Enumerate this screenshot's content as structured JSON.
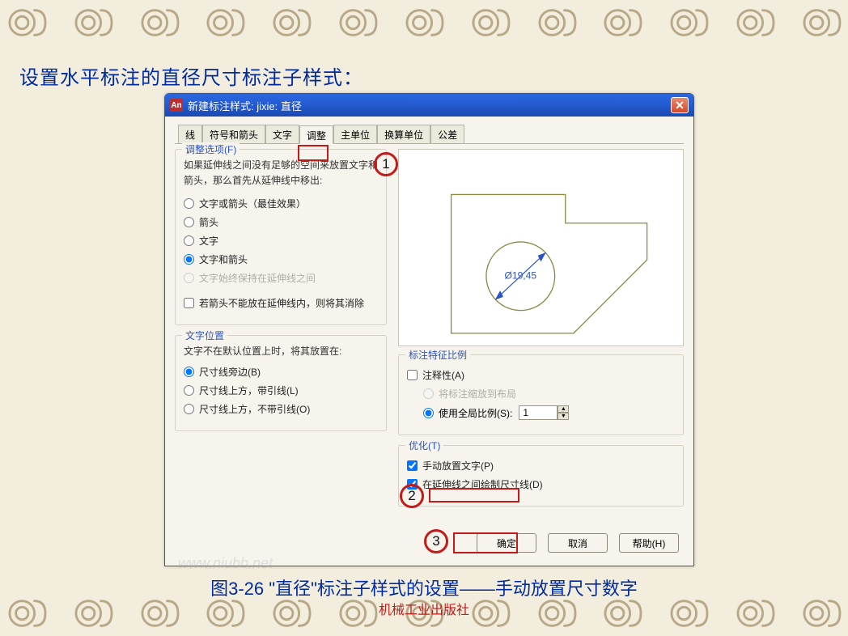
{
  "page": {
    "title": "设置水平标注的直径尺寸标注子样式：",
    "caption": "图3-26  \"直径\"标注子样式的设置——手动放置尺寸数字",
    "publisher": "机械工业出版社",
    "watermark": "www.niubb.net"
  },
  "dialog": {
    "title": "新建标注样式: jixie: 直径",
    "app_icon_text": "An",
    "tabs": [
      "线",
      "符号和箭头",
      "文字",
      "调整",
      "主单位",
      "换算单位",
      "公差"
    ],
    "active_tab_index": 3
  },
  "fit_options": {
    "legend": "调整选项(F)",
    "description": "如果延伸线之间没有足够的空间来放置文字和箭头，那么首先从延伸线中移出:",
    "radios": [
      {
        "label": "文字或箭头（最佳效果）",
        "checked": false,
        "disabled": false
      },
      {
        "label": "箭头",
        "checked": false,
        "disabled": false
      },
      {
        "label": "文字",
        "checked": false,
        "disabled": false
      },
      {
        "label": "文字和箭头",
        "checked": true,
        "disabled": false
      },
      {
        "label": "文字始终保持在延伸线之间",
        "checked": false,
        "disabled": true
      }
    ],
    "suppress_check": {
      "label": "若箭头不能放在延伸线内，则将其消除",
      "checked": false,
      "disabled": false
    }
  },
  "text_placement": {
    "legend": "文字位置",
    "description": "文字不在默认位置上时，将其放置在:",
    "radios": [
      {
        "label": "尺寸线旁边(B)",
        "checked": true
      },
      {
        "label": "尺寸线上方，带引线(L)",
        "checked": false
      },
      {
        "label": "尺寸线上方，不带引线(O)",
        "checked": false
      }
    ]
  },
  "scale": {
    "legend": "标注特征比例",
    "annotative": {
      "label": "注释性(A)",
      "checked": false
    },
    "radio_layout": {
      "label": "将标注缩放到布局",
      "checked": false,
      "disabled": true
    },
    "radio_global": {
      "label": "使用全局比例(S):",
      "checked": true
    },
    "global_value": "1"
  },
  "optimize": {
    "legend": "优化(T)",
    "manual_text": {
      "label": "手动放置文字(P)",
      "checked": true
    },
    "draw_dim_line": {
      "label": "在延伸线之间绘制尺寸线(D)",
      "checked": true
    }
  },
  "preview": {
    "dim_value": "Ø19,45"
  },
  "buttons": {
    "ok": "确定",
    "cancel": "取消",
    "help": "帮助(H)"
  },
  "markers": {
    "one": "1",
    "two": "2",
    "three": "3"
  }
}
